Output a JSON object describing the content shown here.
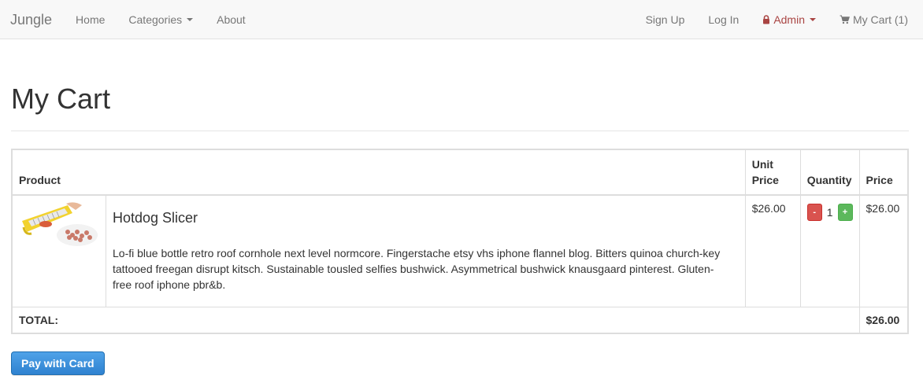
{
  "navbar": {
    "brand": "Jungle",
    "left": [
      {
        "label": "Home"
      },
      {
        "label": "Categories"
      },
      {
        "label": "About"
      }
    ],
    "right": {
      "signup": "Sign Up",
      "login": "Log In",
      "admin": "Admin",
      "cart": "My Cart (1)"
    },
    "colors": {
      "admin": "#a94442"
    }
  },
  "page": {
    "title": "My Cart"
  },
  "table": {
    "headers": {
      "product": "Product",
      "unit_price": "Unit Price",
      "quantity": "Quantity",
      "price": "Price"
    },
    "items": [
      {
        "image_icon": "hotdog-slicer-image",
        "name": "Hotdog Slicer",
        "description": "Lo-fi blue bottle retro roof cornhole next level normcore. Fingerstache etsy vhs iphone flannel blog. Bitters quinoa church-key tattooed freegan disrupt kitsch. Sustainable tousled selfies bushwick. Asymmetrical bushwick knausgaard pinterest. Gluten-free roof iphone pbr&b.",
        "unit_price": "$26.00",
        "minus": "-",
        "quantity": "1",
        "plus": "+",
        "price": "$26.00"
      }
    ],
    "total_label": "TOTAL:",
    "total_value": "$26.00"
  },
  "pay_button": "Pay with Card"
}
